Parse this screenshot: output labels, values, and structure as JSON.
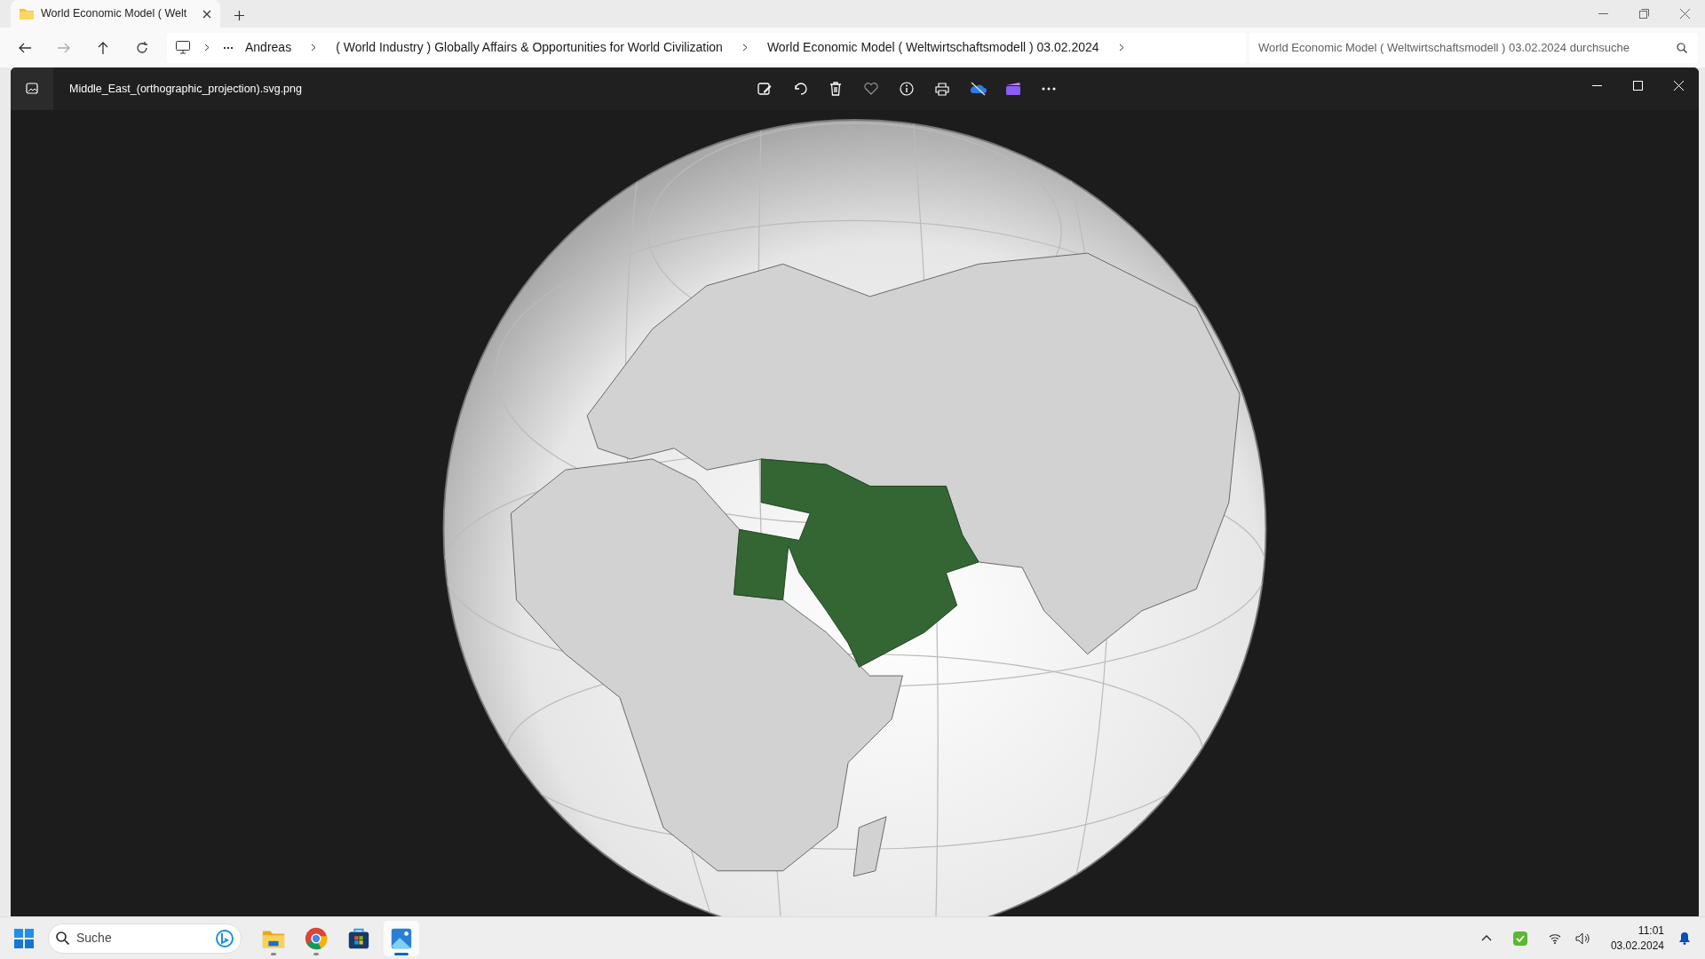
{
  "browser_tab": {
    "title": "World Economic Model ( Welt",
    "selected": true
  },
  "breadcrumb": [
    "Andreas",
    "( World Industry ) Globally Affairs & Opportunities for World Civilization",
    "World Economic Model ( Weltwirtschaftsmodell ) 03.02.2024"
  ],
  "search": {
    "placeholder": "World Economic Model ( Weltwirtschaftsmodell ) 03.02.2024 durchsuche"
  },
  "viewer": {
    "file_name": "Middle_East_(orthographic_projection).svg.png"
  },
  "taskbar": {
    "search_placeholder": "Suche",
    "apps": [
      {
        "kind": "folder",
        "running": true,
        "selected": false
      },
      {
        "kind": "browser",
        "running": true,
        "selected": false
      },
      {
        "kind": "store",
        "running": false,
        "selected": false
      },
      {
        "kind": "photos",
        "running": true,
        "selected": true
      }
    ],
    "time": "11:01",
    "date": "03.02.2024"
  }
}
